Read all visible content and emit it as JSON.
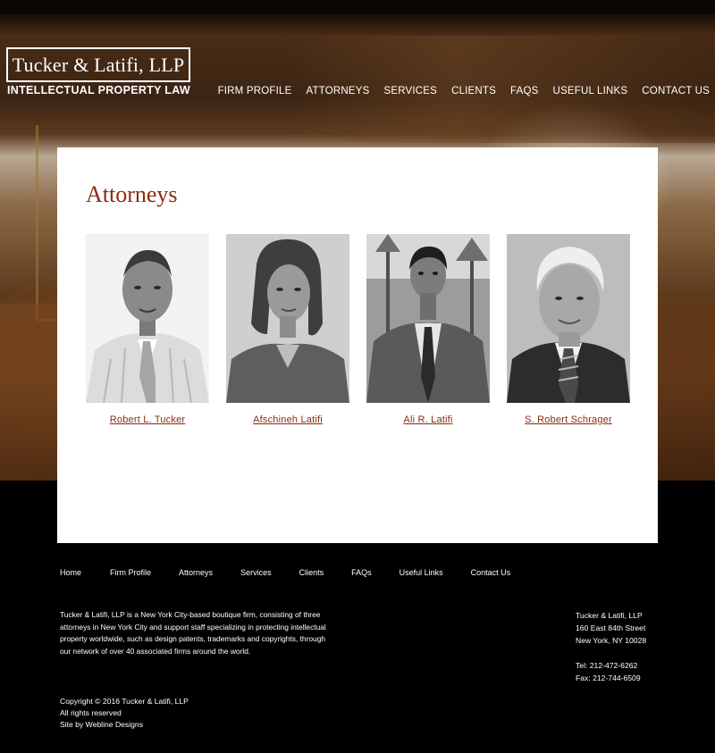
{
  "header": {
    "logo_name": "Tucker & Latifi, LLP",
    "tagline": "INTELLECTUAL PROPERTY LAW",
    "nav": [
      "FIRM PROFILE",
      "ATTORNEYS",
      "SERVICES",
      "CLIENTS",
      "FAQS",
      "USEFUL LINKS",
      "CONTACT US"
    ]
  },
  "main": {
    "title": "Attorneys",
    "attorneys": [
      {
        "name": "Robert L. Tucker"
      },
      {
        "name": "Afschineh Latifi"
      },
      {
        "name": "Ali R. Latifi"
      },
      {
        "name": "S. Robert Schrager"
      }
    ]
  },
  "footer": {
    "nav": [
      "Home",
      "Firm Profile",
      "Attorneys",
      "Services",
      "Clients",
      "FAQs",
      "Useful Links",
      "Contact Us"
    ],
    "about": "Tucker & Latifi, LLP is a New York City-based boutique firm, consisting of three attorneys in New York City and support staff specializing in protecting intellectual property worldwide, such as design patents, trademarks and copyrights, through our network of over 40 associated firms around the world.",
    "address": {
      "firm": "Tucker & Latifi, LLP",
      "street": "160 East 84th Street",
      "city": "New York, NY 10028",
      "tel": "Tel: 212-472-6262",
      "fax": "Fax: 212-744-6509"
    },
    "copyright": "Copyright © 2016 Tucker & Latifi, LLP",
    "rights": "All rights reserved",
    "credit": "Site by Webline Designs"
  },
  "colors": {
    "accent": "#8c2a12",
    "panel": "#ffffff",
    "footer_bg": "#000000"
  }
}
